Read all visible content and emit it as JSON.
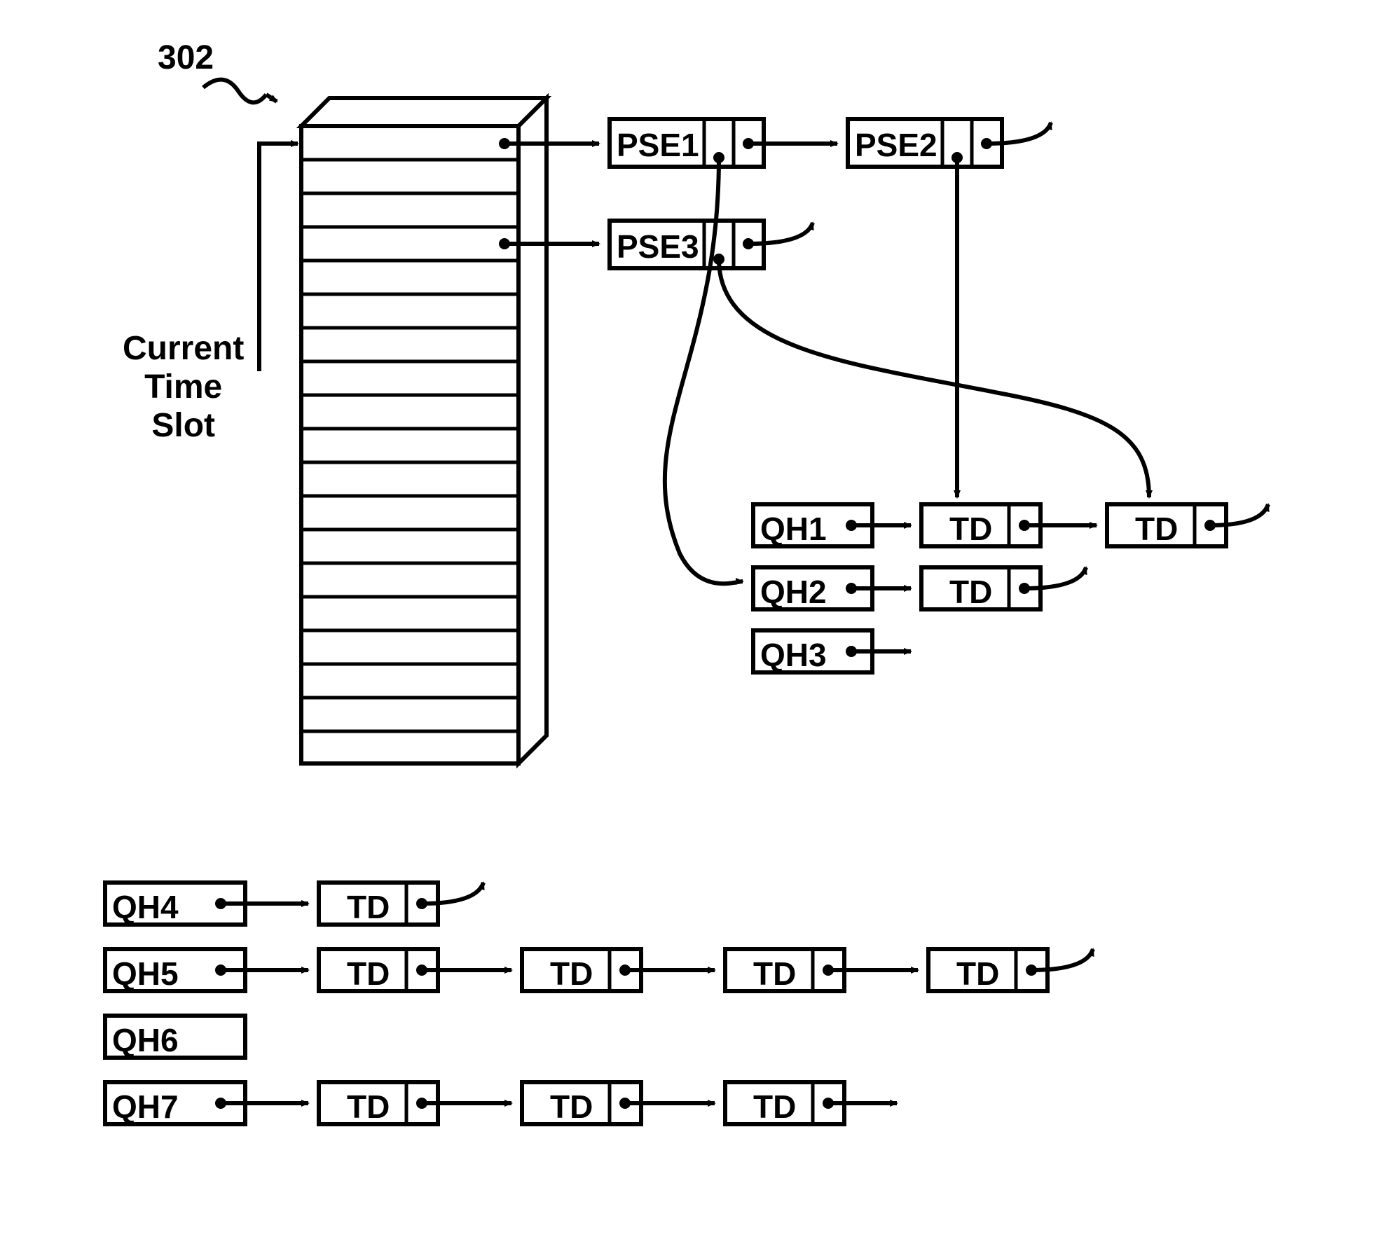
{
  "callout_number": "302",
  "side_label": "Current\nTime\nSlot",
  "nodes": {
    "pse1": "PSE1",
    "pse2": "PSE2",
    "pse3": "PSE3",
    "qh1": "QH1",
    "qh2": "QH2",
    "qh3": "QH3",
    "qh4": "QH4",
    "qh5": "QH5",
    "qh6": "QH6",
    "qh7": "QH7",
    "td": "TD"
  }
}
